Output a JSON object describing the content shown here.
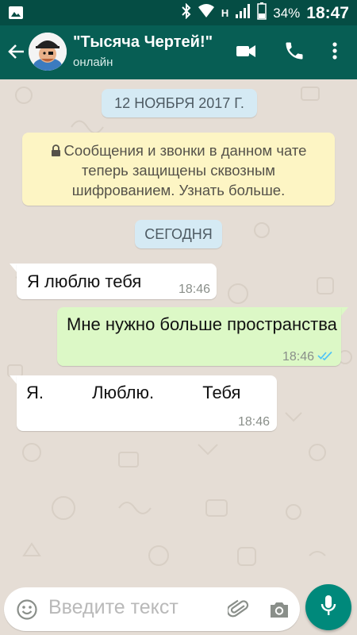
{
  "status_bar": {
    "network": "H",
    "battery": "34%",
    "time": "18:47"
  },
  "header": {
    "title": "\"Тысяча Чертей!\"",
    "status": "онлайн",
    "icons": [
      "back-arrow-icon",
      "video-call-icon",
      "phone-icon",
      "more-vert-icon"
    ]
  },
  "chat": {
    "date_label": "12 НОЯБРЯ 2017 Г.",
    "encryption_notice": "Сообщения и звонки в данном чате теперь защищены сквозным шифрованием. Узнать больше.",
    "today_label": "СЕГОДНЯ",
    "messages": [
      {
        "direction": "incoming",
        "text": "Я люблю тебя",
        "time": "18:46"
      },
      {
        "direction": "outgoing",
        "text": "Мне нужно больше пространства",
        "time": "18:46",
        "ticks": "read"
      },
      {
        "direction": "incoming",
        "text": "Я.          Люблю.          Тебя",
        "time": "18:46"
      }
    ]
  },
  "composer": {
    "placeholder": "Введите текст",
    "icons": [
      "emoji-icon",
      "paperclip-icon",
      "camera-icon",
      "mic-icon"
    ]
  },
  "colors": {
    "header": "#075e54",
    "statusbar": "#054d44",
    "outgoing_bubble": "#dcf8c6",
    "incoming_bubble": "#ffffff",
    "accent": "#00897b",
    "read_ticks": "#4fc3f7"
  }
}
